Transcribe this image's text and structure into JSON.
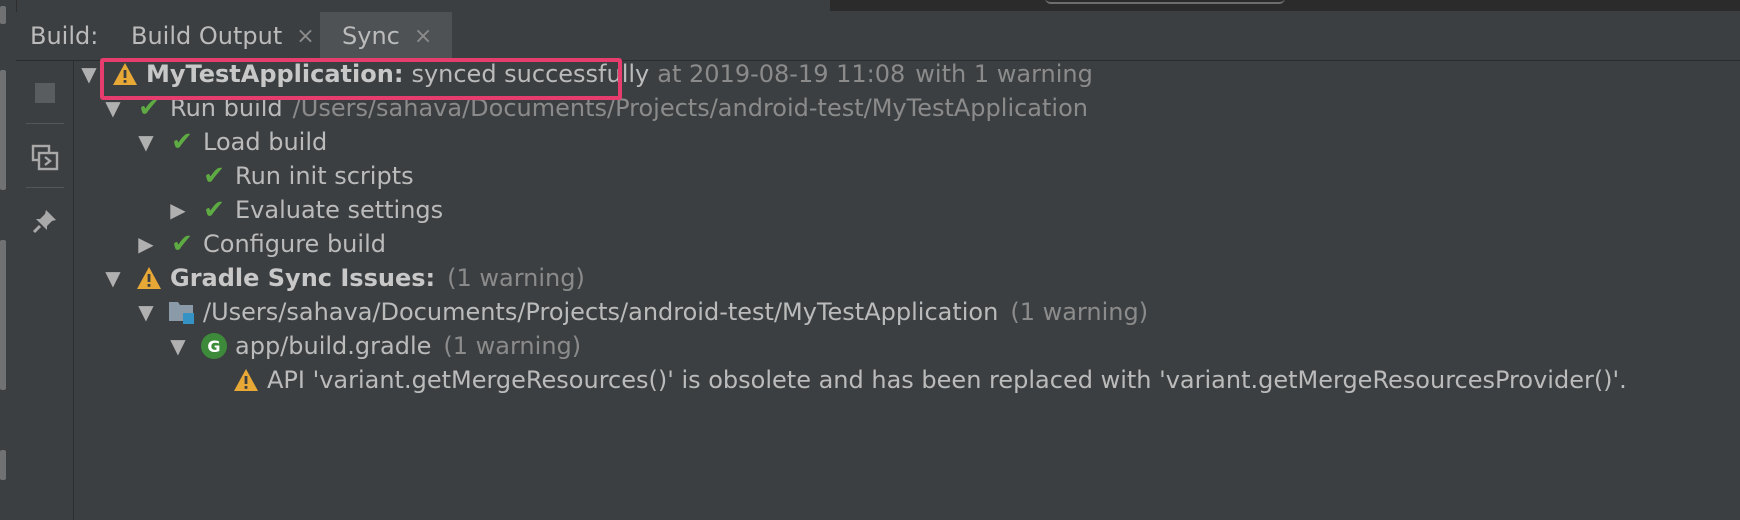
{
  "toolwindow": {
    "build_label": "Build:",
    "tabs": [
      {
        "label": "Build Output",
        "close": "×"
      },
      {
        "label": "Sync",
        "close": "×"
      }
    ]
  },
  "icons": {
    "warning": "warning-icon",
    "success": "check-icon",
    "folder": "folder-icon",
    "gradle": "gradle-icon",
    "gradle_letter": "G"
  },
  "tree": {
    "root": {
      "name": "MyTestApplication:",
      "status": "synced successfully",
      "detail": "at 2019-08-19 11:08",
      "warning_count": "with 1 warning"
    },
    "run_build": {
      "label": "Run build",
      "path": "/Users/sahava/Documents/Projects/android-test/MyTestApplication"
    },
    "load_build": {
      "label": "Load build"
    },
    "run_init_scripts": {
      "label": "Run init scripts"
    },
    "evaluate_settings": {
      "label": "Evaluate settings"
    },
    "configure_build": {
      "label": "Configure build"
    },
    "gradle_sync_issues": {
      "label": "Gradle Sync Issues:",
      "count": "(1 warning)"
    },
    "project_folder": {
      "path": "/Users/sahava/Documents/Projects/android-test/MyTestApplication",
      "count": "(1 warning)"
    },
    "build_gradle": {
      "label": "app/build.gradle",
      "count": "(1 warning)"
    },
    "warning_message": {
      "text": "API 'variant.getMergeResources()' is obsolete and has been replaced with 'variant.getMergeResourcesProvider()'."
    }
  },
  "colors": {
    "background": "#3c3f41",
    "success": "#5fab43",
    "warning": "#e8a836",
    "highlight": "#e63d6e",
    "muted_text": "#8b8b8b"
  }
}
